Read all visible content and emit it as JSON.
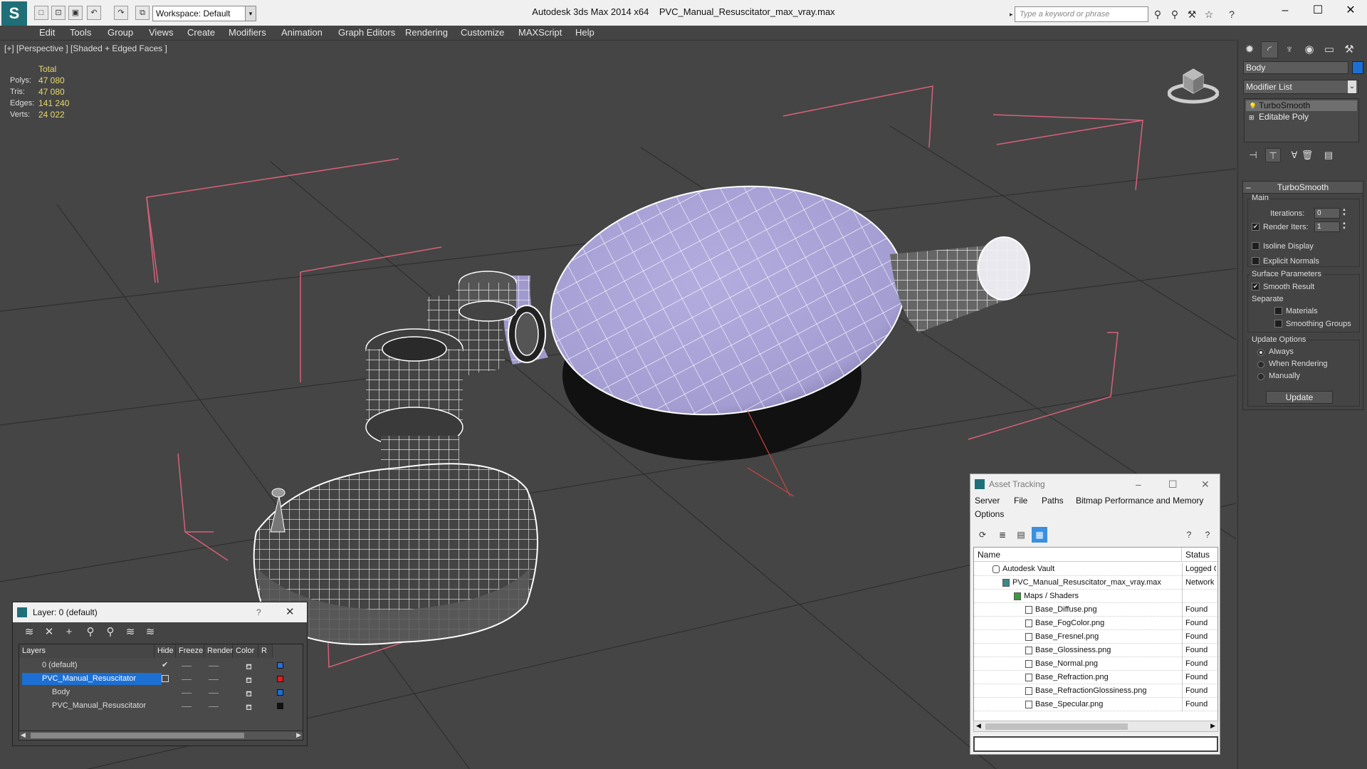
{
  "title": {
    "app": "Autodesk 3ds Max  2014 x64",
    "file": "PVC_Manual_Resuscitator_max_vray.max",
    "workspace_label": "Workspace: Default",
    "search_placeholder": "Type a keyword or phrase"
  },
  "menu": [
    "Edit",
    "Tools",
    "Group",
    "Views",
    "Create",
    "Modifiers",
    "Animation",
    "Graph Editors",
    "Rendering",
    "Customize",
    "MAXScript",
    "Help"
  ],
  "viewport": {
    "label": "[+] [Perspective ] [Shaded + Edged Faces ]",
    "stats": {
      "header": "Total",
      "rows": [
        {
          "label": "Polys:",
          "value": "47 080"
        },
        {
          "label": "Tris:",
          "value": "47 080"
        },
        {
          "label": "Edges:",
          "value": "141 240"
        },
        {
          "label": "Verts:",
          "value": "24 022"
        }
      ]
    }
  },
  "command_panel": {
    "object_name": "Body",
    "object_color": "#1c6fd3",
    "modifier_list": "Modifier List",
    "stack": [
      "TurboSmooth",
      "Editable Poly"
    ],
    "turbosmooth": {
      "title": "TurboSmooth",
      "main_label": "Main",
      "iterations_label": "Iterations:",
      "iterations_value": "0",
      "render_iters_label": "Render Iters:",
      "render_iters_value": "1",
      "render_iters_checked": true,
      "isoline_label": "Isoline Display",
      "isoline_checked": false,
      "explicit_normals_label": "Explicit Normals",
      "explicit_normals_checked": false,
      "surface_params_label": "Surface Parameters",
      "smooth_result_label": "Smooth Result",
      "smooth_result_checked": true,
      "separate_label": "Separate",
      "materials_label": "Materials",
      "materials_checked": false,
      "smoothing_groups_label": "Smoothing Groups",
      "smoothing_groups_checked": false,
      "update_options_label": "Update Options",
      "always_label": "Always",
      "when_rendering_label": "When Rendering",
      "manually_label": "Manually",
      "update_mode": "Always",
      "update_button": "Update"
    }
  },
  "layer_dialog": {
    "title": "Layer: 0 (default)",
    "help": "?",
    "columns": [
      "Layers",
      "Hide",
      "Freeze",
      "Render",
      "Color",
      "R"
    ],
    "rows": [
      {
        "name": "0 (default)",
        "color": "#2a6fd8",
        "selected": false,
        "indent": 1,
        "current": true
      },
      {
        "name": "PVC_Manual_Resuscitator",
        "color": "#e02020",
        "selected": true,
        "indent": 0,
        "current": false
      },
      {
        "name": "Body",
        "color": "#1c6fd3",
        "selected": false,
        "indent": 2,
        "current": false
      },
      {
        "name": "PVC_Manual_Resuscitator",
        "color": "#111111",
        "selected": false,
        "indent": 2,
        "current": false
      }
    ]
  },
  "asset_tracking": {
    "title": "Asset Tracking",
    "menu": [
      "Server",
      "File",
      "Paths",
      "Bitmap Performance and Memory",
      "Options"
    ],
    "columns": [
      "Name",
      "Status"
    ],
    "rows": [
      {
        "name": "Autodesk Vault",
        "status": "Logged O",
        "indent": 0
      },
      {
        "name": "PVC_Manual_Resuscitator_max_vray.max",
        "status": "Network",
        "indent": 1
      },
      {
        "name": "Maps / Shaders",
        "status": "",
        "indent": 2
      },
      {
        "name": "Base_Diffuse.png",
        "status": "Found",
        "indent": 3
      },
      {
        "name": "Base_FogColor.png",
        "status": "Found",
        "indent": 3
      },
      {
        "name": "Base_Fresnel.png",
        "status": "Found",
        "indent": 3
      },
      {
        "name": "Base_Glossiness.png",
        "status": "Found",
        "indent": 3
      },
      {
        "name": "Base_Normal.png",
        "status": "Found",
        "indent": 3
      },
      {
        "name": "Base_Refraction.png",
        "status": "Found",
        "indent": 3
      },
      {
        "name": "Base_RefractionGlossiness.png",
        "status": "Found",
        "indent": 3
      },
      {
        "name": "Base_Specular.png",
        "status": "Found",
        "indent": 3
      }
    ]
  },
  "colors": {
    "viewport_bg": "#454545",
    "bulb_fill": "#a9a3d6",
    "wire": "#ffffff",
    "bbox": "#d9607a",
    "accent": "#1c6fd3"
  }
}
